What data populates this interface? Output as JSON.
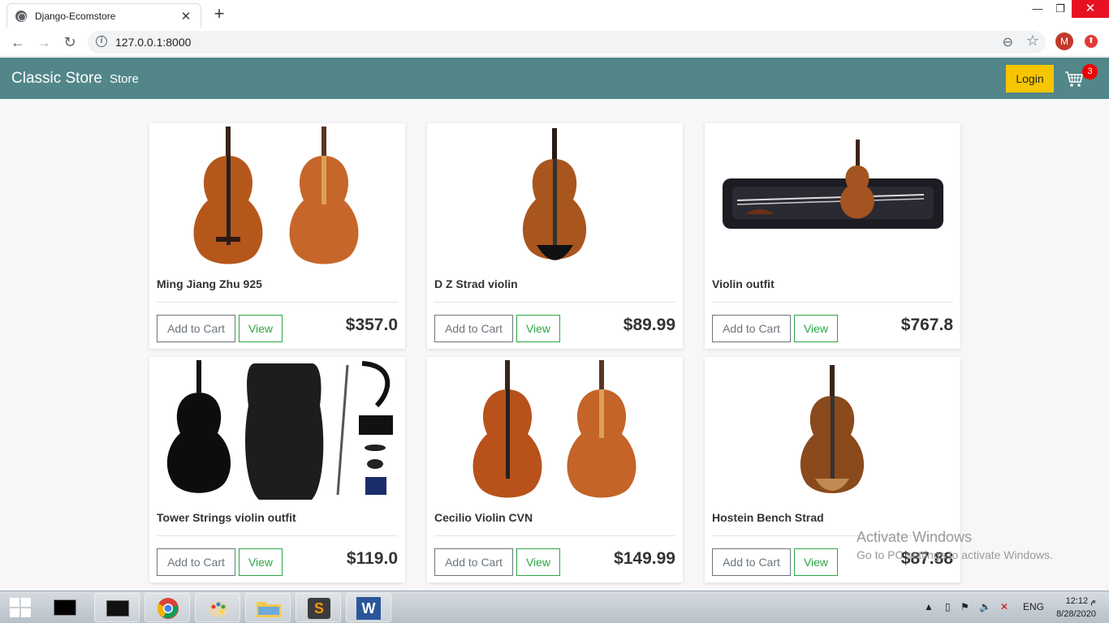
{
  "browser": {
    "tab_title": "Django-Ecomstore",
    "url": "127.0.0.1:8000",
    "profile_initial": "M"
  },
  "site": {
    "brand": "Classic Store",
    "nav_link": "Store",
    "login_label": "Login",
    "cart_count": "3",
    "colors": {
      "navbar": "#528689",
      "login": "#f7c600",
      "view": "#28a745"
    }
  },
  "products": [
    {
      "name": "Ming Jiang Zhu 925",
      "price": "$357.0",
      "add_label": "Add to Cart",
      "view_label": "View"
    },
    {
      "name": "D Z Strad violin",
      "price": "$89.99",
      "add_label": "Add to Cart",
      "view_label": "View"
    },
    {
      "name": "Violin outfit",
      "price": "$767.8",
      "add_label": "Add to Cart",
      "view_label": "View"
    },
    {
      "name": "Tower Strings violin outfit",
      "price": "$119.0",
      "add_label": "Add to Cart",
      "view_label": "View"
    },
    {
      "name": "Cecilio Violin CVN",
      "price": "$149.99",
      "add_label": "Add to Cart",
      "view_label": "View"
    },
    {
      "name": "Hostein Bench Strad",
      "price": "$87.88",
      "add_label": "Add to Cart",
      "view_label": "View"
    }
  ],
  "watermark": {
    "line1": "Activate Windows",
    "line2": "Go to PC settings to activate Windows."
  },
  "taskbar": {
    "lang": "ENG",
    "time": "12:12 م",
    "date": "8/28/2020"
  }
}
